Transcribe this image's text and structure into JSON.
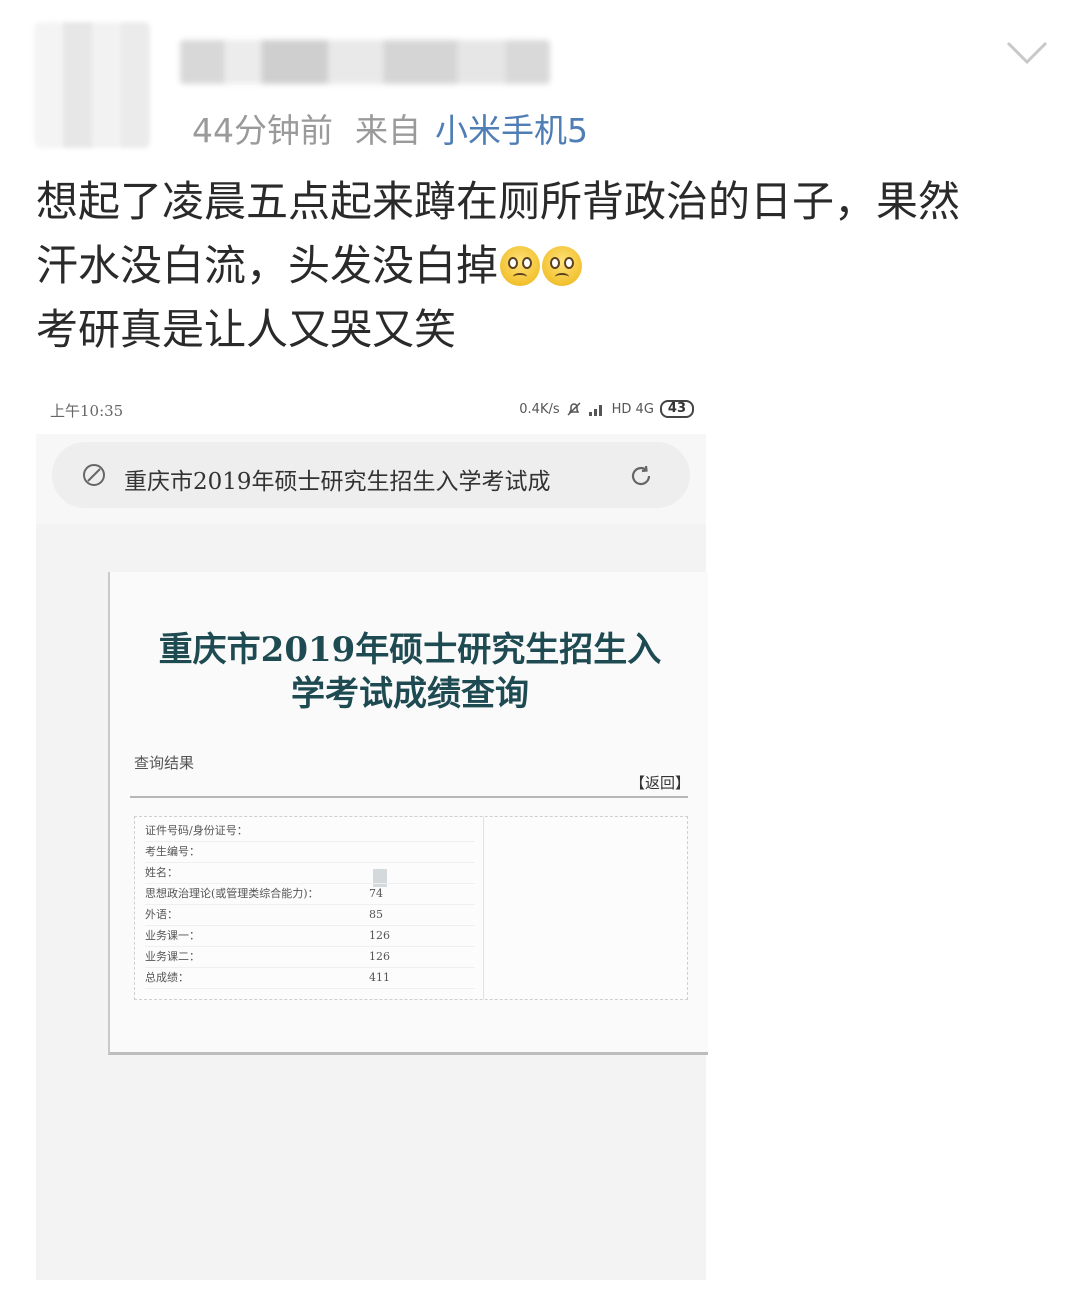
{
  "header": {
    "time_ago": "44分钟前",
    "source_label": "来自",
    "device": "小米手机5"
  },
  "post": {
    "line1": "想起了凌晨五点起来蹲在厕所背政治的日子，果然",
    "line2": "汗水没白流，头发没白掉",
    "line3": "考研真是让人又哭又笑",
    "emojis": [
      "crying-face",
      "crying-face"
    ]
  },
  "screenshot": {
    "status_bar": {
      "time": "上午10:35",
      "net_speed": "0.4K/s",
      "network": "HD 4G",
      "battery": "43"
    },
    "url_bar": {
      "text": "重庆市2019年硕士研究生招生入学考试成"
    },
    "page": {
      "title_line1": "重庆市2019年硕士研究生招生入",
      "title_line2": "学考试成绩查询",
      "result_label": "查询结果",
      "back_link": "【返回】",
      "rows": [
        {
          "label": "证件号码/身份证号：",
          "value": ""
        },
        {
          "label": "考生编号：",
          "value": ""
        },
        {
          "label": "姓名：",
          "value": ""
        },
        {
          "label": "思想政治理论(或管理类综合能力)：",
          "value": "74"
        },
        {
          "label": "外语：",
          "value": "85"
        },
        {
          "label": "业务课一：",
          "value": "126"
        },
        {
          "label": "业务课二：",
          "value": "126"
        },
        {
          "label": "总成绩：",
          "value": "411"
        }
      ]
    }
  }
}
